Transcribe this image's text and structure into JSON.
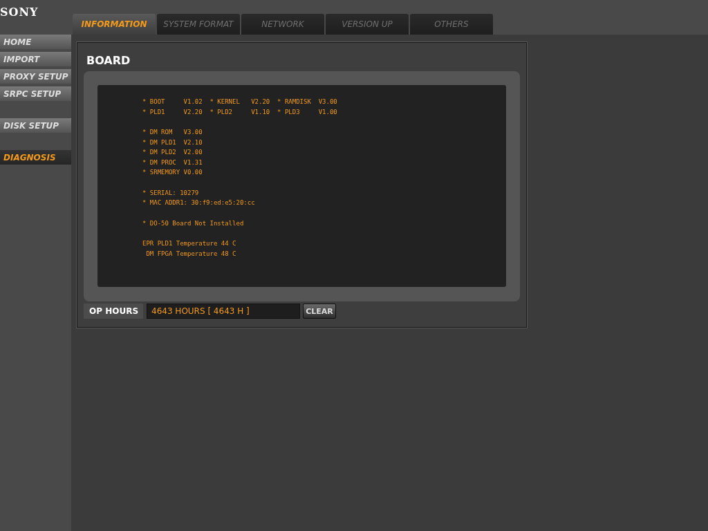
{
  "logo": "SONY",
  "tabs": [
    {
      "label": "INFORMATION",
      "selected": true
    },
    {
      "label": "SYSTEM FORMAT",
      "selected": false
    },
    {
      "label": "NETWORK",
      "selected": false
    },
    {
      "label": "VERSION UP",
      "selected": false
    },
    {
      "label": "OTHERS",
      "selected": false
    }
  ],
  "sidebar": {
    "groups": [
      [
        {
          "label": "HOME",
          "selected": false
        },
        {
          "label": "IMPORT",
          "selected": false
        },
        {
          "label": "PROXY SETUP",
          "selected": false
        },
        {
          "label": "SRPC SETUP",
          "selected": false
        }
      ],
      [
        {
          "label": "DISK SETUP",
          "selected": false
        }
      ],
      [
        {
          "label": "DIAGNOSIS",
          "selected": true
        }
      ]
    ]
  },
  "panel": {
    "title": "BOARD",
    "console": [
      [
        "* BOOT     V1.02  * KERNEL   V2.20  * RAMDISK  V3.00",
        "* PLD1     V2.20  * PLD2     V1.10  * PLD3     V1.00"
      ],
      [
        "* DM ROM   V3.00",
        "* DM PLD1  V2.10",
        "* DM PLD2  V2.00",
        "* DM PROC  V1.31",
        "* SRMEMORY V0.00"
      ],
      [
        "* SERIAL: 10279",
        "* MAC ADDR1: 30:f9:ed:e5:20:cc"
      ],
      [
        "* DO-50 Board Not Installed"
      ],
      [
        "EPR PLD1 Temperature 44 C",
        " DM FPGA Temperature 48 C"
      ]
    ],
    "op_hours": {
      "label": "OP HOURS",
      "value": "4643 HOURS [ 4643 H ]",
      "button": "CLEAR"
    }
  }
}
